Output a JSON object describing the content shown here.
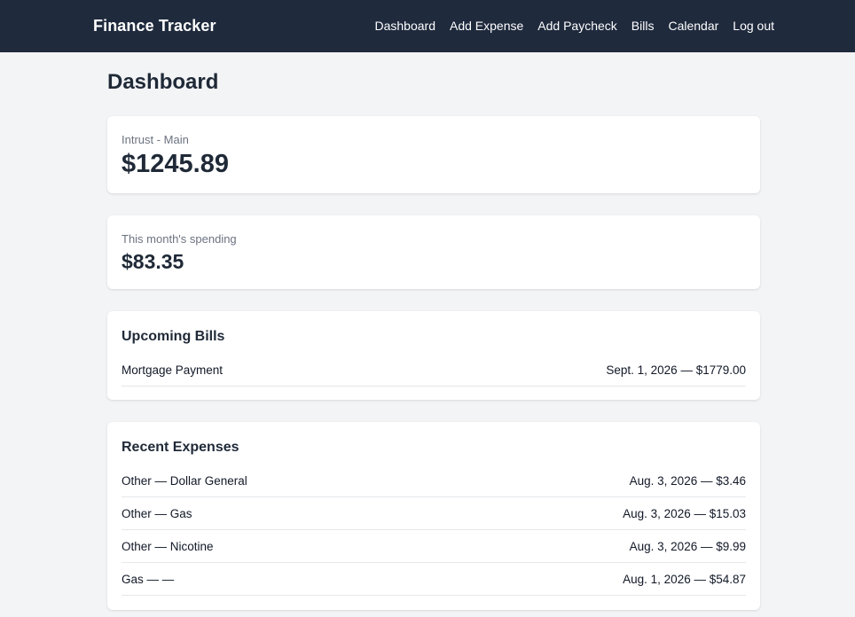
{
  "nav": {
    "brand": "Finance Tracker",
    "links": [
      "Dashboard",
      "Add Expense",
      "Add Paycheck",
      "Bills",
      "Calendar",
      "Log out"
    ]
  },
  "page": {
    "title": "Dashboard"
  },
  "account": {
    "name": "Intrust - Main",
    "balance": "$1245.89"
  },
  "spending": {
    "label": "This month's spending",
    "amount": "$83.35"
  },
  "bills": {
    "heading": "Upcoming Bills",
    "items": [
      {
        "name": "Mortgage Payment",
        "detail": "Sept. 1, 2026 — $1779.00"
      }
    ]
  },
  "expenses": {
    "heading": "Recent Expenses",
    "items": [
      {
        "name": "Other — Dollar General",
        "detail": "Aug. 3, 2026 — $3.46"
      },
      {
        "name": "Other — Gas",
        "detail": "Aug. 3, 2026 — $15.03"
      },
      {
        "name": "Other — Nicotine",
        "detail": "Aug. 3, 2026 — $9.99"
      },
      {
        "name": "Gas — —",
        "detail": "Aug. 1, 2026 — $54.87"
      }
    ]
  }
}
